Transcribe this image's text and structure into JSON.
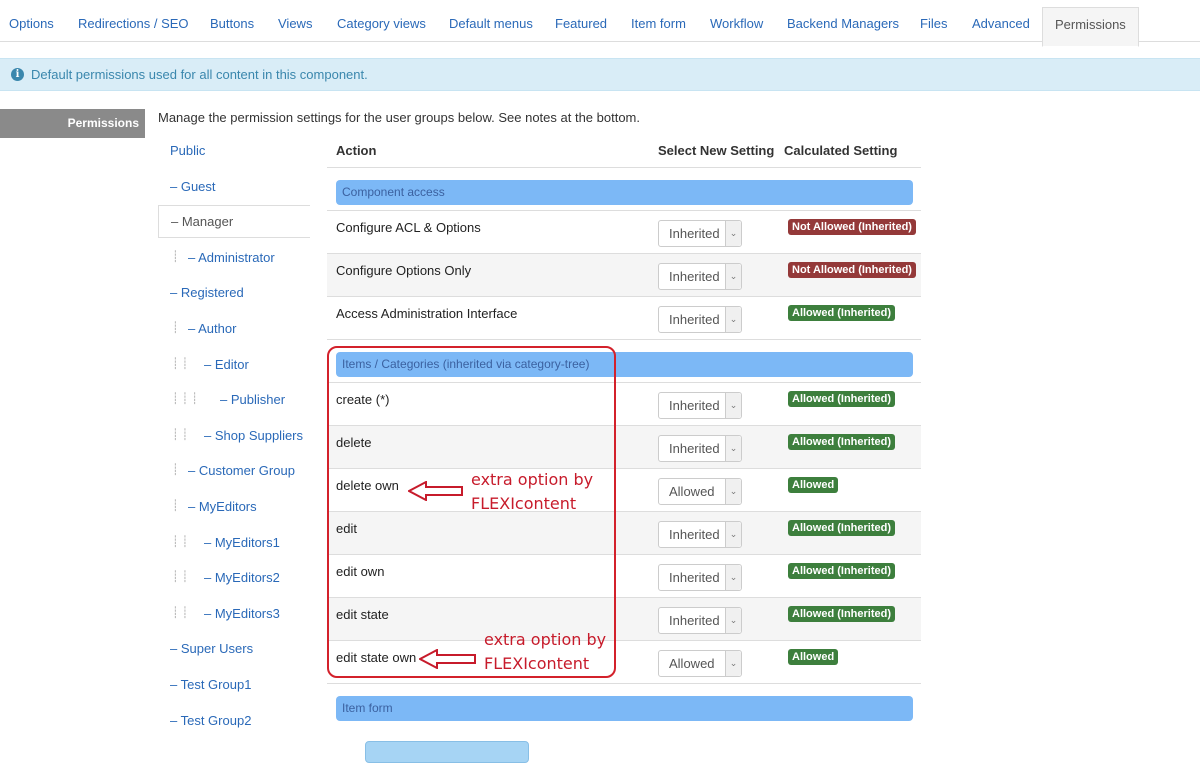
{
  "tabs": [
    "Options",
    "Redirections / SEO",
    "Buttons",
    "Views",
    "Category views",
    "Default menus",
    "Featured",
    "Item form",
    "Workflow",
    "Backend Managers",
    "Files",
    "Advanced",
    "Permissions"
  ],
  "info": {
    "icon": "info-icon",
    "text": "Default permissions used for all content in this component."
  },
  "side_tab": "Permissions",
  "intro": "Manage the permission settings for the user groups below. See notes at the bottom.",
  "groups": [
    {
      "label": "Public",
      "depth": 0,
      "active": false
    },
    {
      "label": "– Guest",
      "depth": 0,
      "active": false
    },
    {
      "label": "– Manager",
      "depth": 0,
      "active": true
    },
    {
      "label": "– Administrator",
      "depth": 1,
      "active": false
    },
    {
      "label": "– Registered",
      "depth": 0,
      "active": false
    },
    {
      "label": "– Author",
      "depth": 1,
      "active": false
    },
    {
      "label": "– Editor",
      "depth": 2,
      "active": false
    },
    {
      "label": "– Publisher",
      "depth": 3,
      "active": false
    },
    {
      "label": "– Shop Suppliers",
      "depth": 2,
      "active": false
    },
    {
      "label": "– Customer Group",
      "depth": 1,
      "active": false
    },
    {
      "label": "– MyEditors",
      "depth": 1,
      "active": false
    },
    {
      "label": "– MyEditors1",
      "depth": 2,
      "active": false
    },
    {
      "label": "– MyEditors2",
      "depth": 2,
      "active": false
    },
    {
      "label": "– MyEditors3",
      "depth": 2,
      "active": false
    },
    {
      "label": "– Super Users",
      "depth": 0,
      "active": false
    },
    {
      "label": "– Test Group1",
      "depth": 0,
      "active": false
    },
    {
      "label": "– Test Group2",
      "depth": 0,
      "active": false
    }
  ],
  "table": {
    "headers": {
      "action": "Action",
      "select": "Select New Setting",
      "calc": "Calculated Setting"
    },
    "rows": [
      {
        "type": "section",
        "label": "Component access"
      },
      {
        "type": "action",
        "label": "Configure ACL & Options",
        "setting": "Inherited",
        "calc": "Not Allowed (Inherited)",
        "status": "na"
      },
      {
        "type": "action",
        "label": "Configure Options Only",
        "setting": "Inherited",
        "calc": "Not Allowed (Inherited)",
        "status": "na"
      },
      {
        "type": "action",
        "label": "Access Administration Interface",
        "setting": "Inherited",
        "calc": "Allowed (Inherited)",
        "status": "ok"
      },
      {
        "type": "section",
        "label": "Items / Categories (inherited via category-tree)"
      },
      {
        "type": "action",
        "label": "create (*)",
        "setting": "Inherited",
        "calc": "Allowed (Inherited)",
        "status": "ok"
      },
      {
        "type": "action",
        "label": "delete",
        "setting": "Inherited",
        "calc": "Allowed (Inherited)",
        "status": "ok"
      },
      {
        "type": "action",
        "label": "delete own",
        "setting": "Allowed",
        "calc": "Allowed",
        "status": "ok"
      },
      {
        "type": "action",
        "label": "edit",
        "setting": "Inherited",
        "calc": "Allowed (Inherited)",
        "status": "ok"
      },
      {
        "type": "action",
        "label": "edit own",
        "setting": "Inherited",
        "calc": "Allowed (Inherited)",
        "status": "ok"
      },
      {
        "type": "action",
        "label": "edit state",
        "setting": "Inherited",
        "calc": "Allowed (Inherited)",
        "status": "ok"
      },
      {
        "type": "action",
        "label": "edit state own",
        "setting": "Allowed",
        "calc": "Allowed",
        "status": "ok"
      },
      {
        "type": "section",
        "label": "Item form"
      }
    ]
  },
  "annotations": [
    {
      "line1": "extra option by",
      "line2": "FLEXIcontent"
    },
    {
      "line1": "extra option by",
      "line2": "FLEXIcontent"
    }
  ],
  "colors": {
    "link": "#2a69b8",
    "section_bar": "#7cb8f6",
    "not_allowed": "#943939",
    "allowed": "#3d7f3d",
    "annotation": "#c71b2b"
  }
}
